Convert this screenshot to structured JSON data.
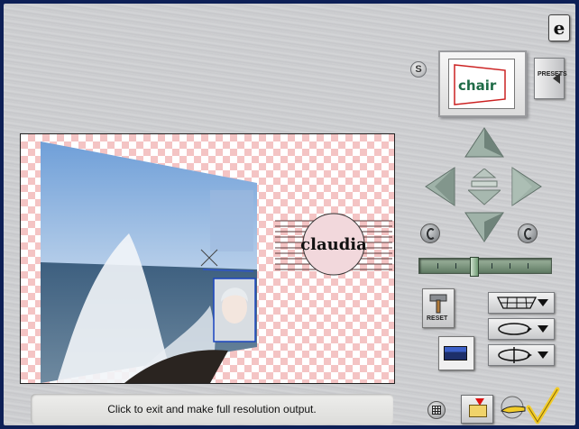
{
  "window": {
    "logo_glyph": "e"
  },
  "sidebar": {
    "s_button_label": "S",
    "presets_label": "PRESETS",
    "preview_text": "chair",
    "reset_label": "RESET"
  },
  "canvas": {
    "logo_text": "claudia"
  },
  "status": {
    "message": "Click to exit and make full resolution output."
  },
  "icons": {
    "up": "triangle-up-icon",
    "down": "triangle-down-icon",
    "left": "triangle-left-icon",
    "right": "triangle-right-icon",
    "rotate_left": "rotate-left-icon",
    "rotate_right": "rotate-right-icon",
    "grid": "grid-icon",
    "folder": "folder-icon",
    "hand": "hand-pointing-icon",
    "check": "checkmark-icon"
  },
  "colors": {
    "checker_pink": "#f4c4c4",
    "nav_green": "#8fa39a",
    "check_yellow": "#f2cc2a"
  }
}
